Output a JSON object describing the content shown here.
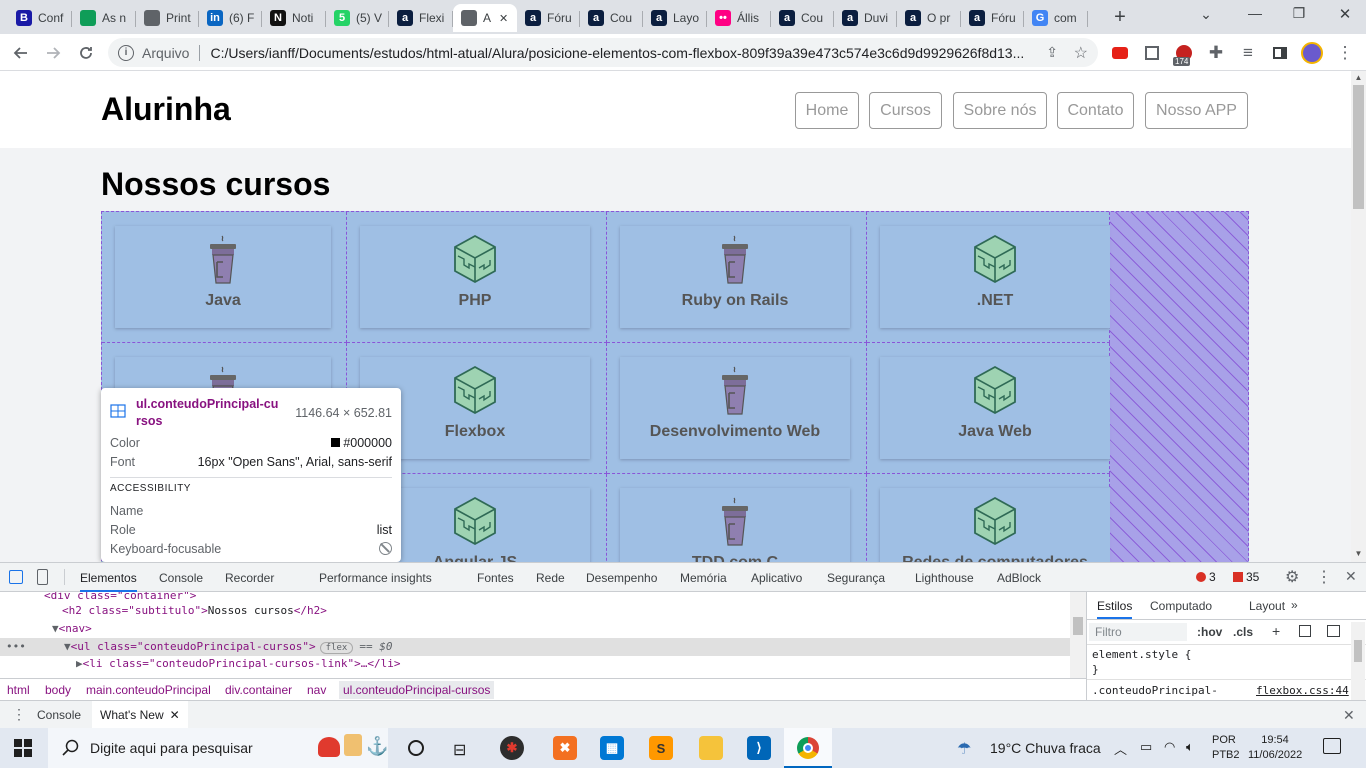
{
  "tabs": [
    {
      "title": "Conf",
      "favicon": "B",
      "color": "#1a1aa6"
    },
    {
      "title": "As n",
      "favicon": "",
      "color": "#0f9d58"
    },
    {
      "title": "Print",
      "favicon": "",
      "color": "#5f6368"
    },
    {
      "title": "(6) F",
      "favicon": "in",
      "color": "#0a66c2"
    },
    {
      "title": "Noti",
      "favicon": "N",
      "color": "#111"
    },
    {
      "title": "(5) V",
      "favicon": "5",
      "color": "#25d366"
    },
    {
      "title": "Flexi",
      "favicon": "a",
      "color": "#0b1e3f"
    },
    {
      "title": "A",
      "favicon": "",
      "color": "#5f6368"
    },
    {
      "title": "Fóru",
      "favicon": "a",
      "color": "#0b1e3f"
    },
    {
      "title": "Cou",
      "favicon": "a",
      "color": "#0b1e3f"
    },
    {
      "title": "Layo",
      "favicon": "a",
      "color": "#0b1e3f"
    },
    {
      "title": "Állis",
      "favicon": "••",
      "color": "#ff0084"
    },
    {
      "title": "Cou",
      "favicon": "a",
      "color": "#0b1e3f"
    },
    {
      "title": "Duvi",
      "favicon": "a",
      "color": "#0b1e3f"
    },
    {
      "title": "O pr",
      "favicon": "a",
      "color": "#0b1e3f"
    },
    {
      "title": "Fóru",
      "favicon": "a",
      "color": "#0b1e3f"
    },
    {
      "title": "com",
      "favicon": "G",
      "color": "#4285f4"
    }
  ],
  "tab_close": "✕",
  "new_tab": "+",
  "window_controls": {
    "dropdown": "⌄",
    "minimize": "—",
    "restore": "❐",
    "close": "✕"
  },
  "address": {
    "scheme_label": "Arquivo",
    "url": "C:/Users/ianff/Documents/estudos/html-atual/Alura/posicione-elementos-com-flexbox-809f39a39e473c574e3c6d9d9929626f8d13..."
  },
  "extension_badge": "174",
  "site": {
    "logo": "Alurinha",
    "nav": [
      "Home",
      "Cursos",
      "Sobre nós",
      "Contato",
      "Nosso APP"
    ],
    "section_title": "Nossos cursos",
    "courses": [
      {
        "label": "Java",
        "icon": "cup"
      },
      {
        "label": "PHP",
        "icon": "cube"
      },
      {
        "label": "Ruby on Rails",
        "icon": "cup"
      },
      {
        "label": ".NET",
        "icon": "cube"
      },
      {
        "label": "",
        "icon": "cup"
      },
      {
        "label": "Flexbox",
        "icon": "cube"
      },
      {
        "label": "Desenvolvimento Web",
        "icon": "cup"
      },
      {
        "label": "Java Web",
        "icon": "cube"
      },
      {
        "label": "Angular JS",
        "icon": "cup"
      },
      {
        "label": "Angular JS",
        "icon": "cube"
      },
      {
        "label": "TDD com C",
        "icon": "cup"
      },
      {
        "label": "Redes de computadores",
        "icon": "cube"
      }
    ]
  },
  "inspect_tooltip": {
    "selector": "ul.conteudoPrincipal-cursos",
    "selector_line1": "ul.conteudoPrincipal-cu",
    "selector_line2": "rsos",
    "size": "1146.64 × 652.81",
    "color_label": "Color",
    "color_value": "#000000",
    "font_label": "Font",
    "font_value": "16px \"Open Sans\", Arial, sans-serif",
    "accessibility_header": "ACCESSIBILITY",
    "name_label": "Name",
    "name_value": "",
    "role_label": "Role",
    "role_value": "list",
    "keyboard_label": "Keyboard-focusable"
  },
  "devtools": {
    "tabs": [
      "Elementos",
      "Console",
      "Recorder",
      "Performance insights",
      "Fontes",
      "Rede",
      "Desempenho",
      "Memória",
      "Aplicativo",
      "Segurança",
      "Lighthouse",
      "AdBlock"
    ],
    "error_count": "3",
    "warning_count": "35",
    "dom": {
      "line0": "<div class=\"container\">",
      "line1_open": "<h2 class=\"subtitulo\">",
      "line1_text": "Nossos cursos",
      "line1_close": "</h2>",
      "line2": "<nav>",
      "line3_open": "<ul class=\"conteudoPrincipal-cursos\">",
      "line3_badge": "flex",
      "line3_suffix": "== $0",
      "line4": "<li class=\"conteudoPrincipal-cursos-link\">…</li>"
    },
    "breadcrumb": [
      "html",
      "body",
      "main.conteudoPrincipal",
      "div.container",
      "nav",
      "ul.conteudoPrincipal-cursos"
    ],
    "styles_tabs": [
      "Estilos",
      "Computado",
      "Layout"
    ],
    "filter_placeholder": "Filtro",
    "hov": ":hov",
    "cls": ".cls",
    "element_style": "element.style {",
    "element_style_close": "}",
    "rule_selector": ".conteudoPrincipal-",
    "rule_source": "flexbox.css:44",
    "drawer_tabs": [
      "Console",
      "What's New"
    ]
  },
  "taskbar": {
    "search_placeholder": "Digite aqui para pesquisar",
    "weather": "19°C  Chuva fraca",
    "lang": "POR",
    "layout": "PTB2",
    "time": "19:54",
    "date": "11/06/2022"
  }
}
